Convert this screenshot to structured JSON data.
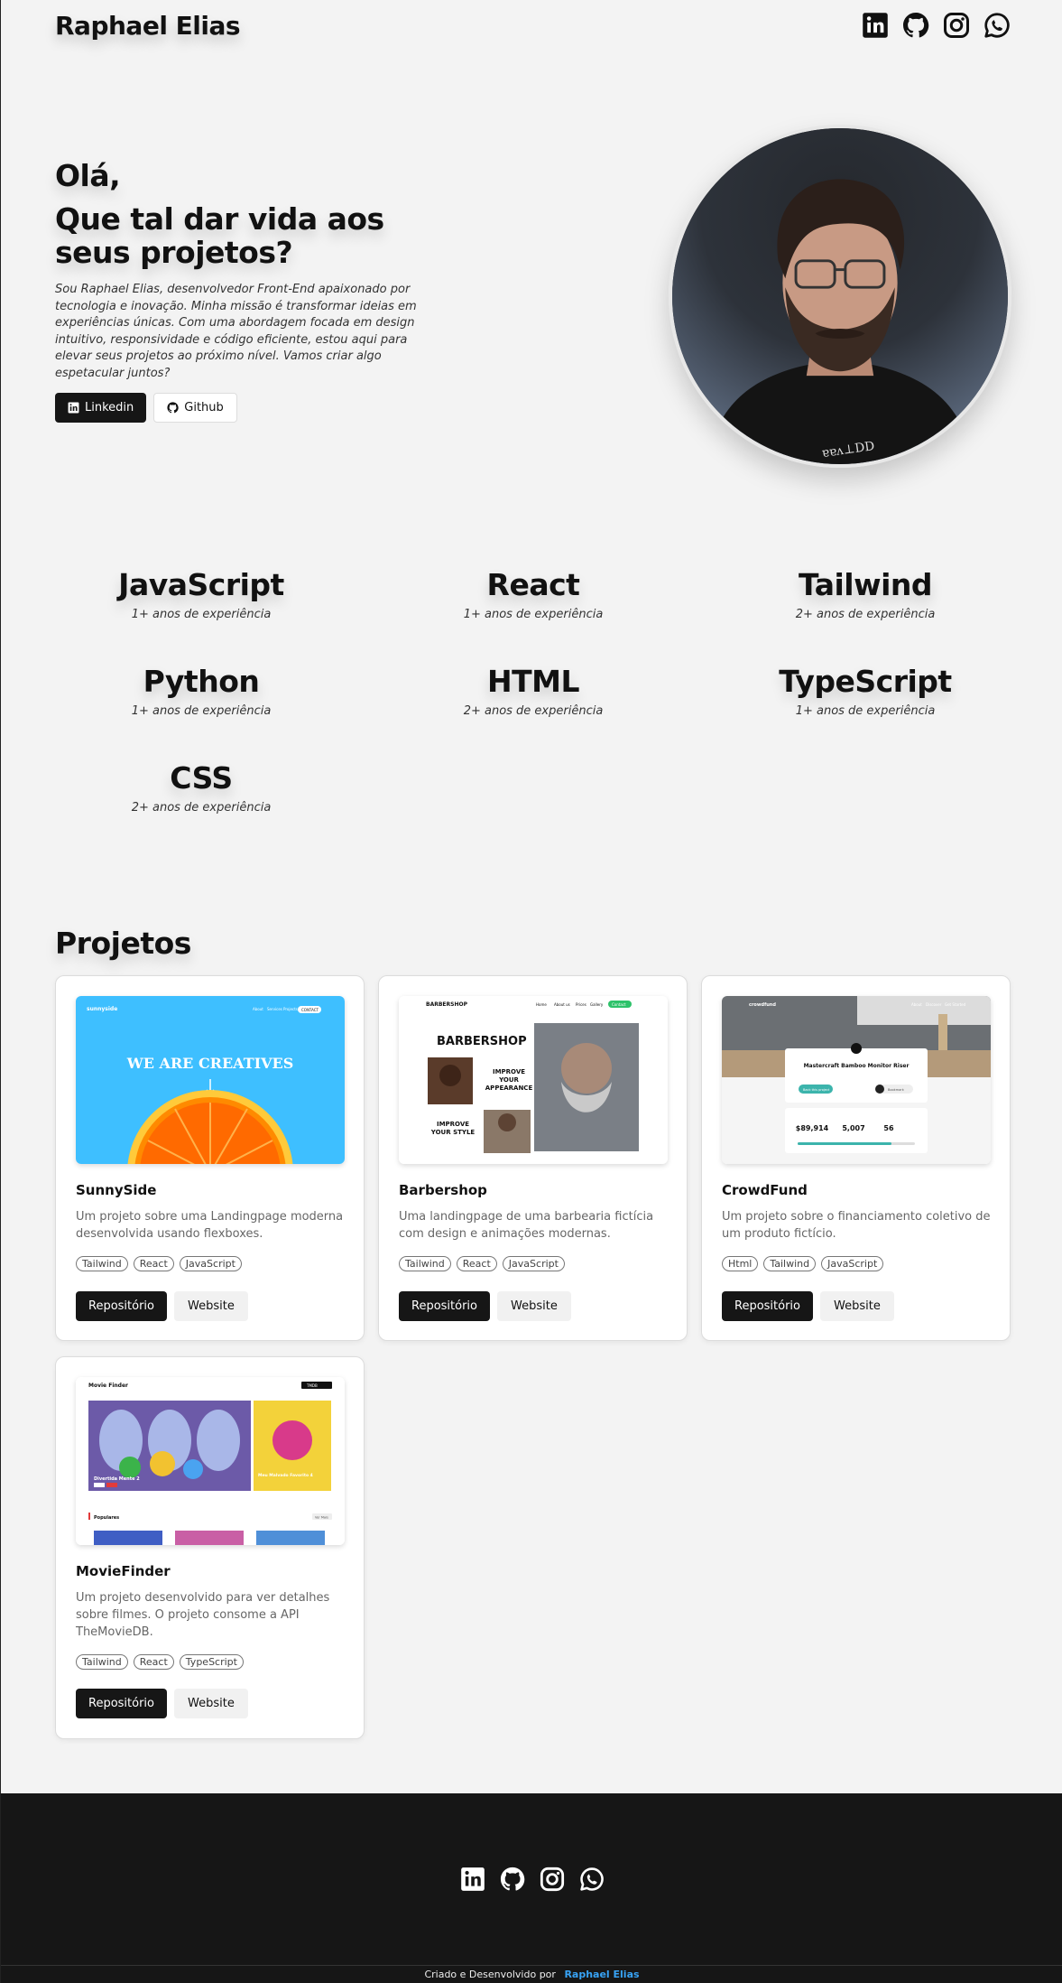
{
  "header": {
    "brand": "Raphael Elias",
    "social_icons": [
      "linkedin-icon",
      "github-icon",
      "instagram-icon",
      "whatsapp-icon"
    ]
  },
  "hero": {
    "greeting": "Olá,",
    "title": "Que tal dar vida aos seus projetos?",
    "description": "Sou Raphael Elias, desenvolvedor Front-End apaixonado por tecnologia e inovação. Minha missão é transformar ideias em experiências únicas. Com uma abordagem focada em design intuitivo, responsividade e código eficiente, estou aqui para elevar seus projetos ao próximo nível. Vamos criar algo espetacular juntos?",
    "buttons": [
      {
        "label": "Linkedin",
        "icon": "linkedin-icon"
      },
      {
        "label": "Github",
        "icon": "github-icon"
      }
    ]
  },
  "skills": [
    {
      "name": "JavaScript",
      "experience": "1+ anos de experiência"
    },
    {
      "name": "React",
      "experience": "1+ anos de experiência"
    },
    {
      "name": "Tailwind",
      "experience": "2+ anos de experiência"
    },
    {
      "name": "Python",
      "experience": "1+ anos de experiência"
    },
    {
      "name": "HTML",
      "experience": "2+ anos de experiência"
    },
    {
      "name": "TypeScript",
      "experience": "1+ anos de experiência"
    },
    {
      "name": "CSS",
      "experience": "2+ anos de experiência"
    }
  ],
  "projects": {
    "heading": "Projetos",
    "items": [
      {
        "title": "SunnySide",
        "description": "Um projeto sobre uma Landingpage moderna desenvolvida usando flexboxes.",
        "tags": [
          "Tailwind",
          "React",
          "JavaScript"
        ],
        "repo_label": "Repositório",
        "site_label": "Website",
        "thumb": {
          "logo": "sunnyside",
          "nav": [
            "About",
            "Services",
            "Projects"
          ],
          "cta": "CONTACT",
          "headline": "WE ARE CREATIVES"
        }
      },
      {
        "title": "Barbershop",
        "description": "Uma landingpage de uma barbearia fictícia com design e animações modernas.",
        "tags": [
          "Tailwind",
          "React",
          "JavaScript"
        ],
        "repo_label": "Repositório",
        "site_label": "Website",
        "thumb": {
          "logo": "BARBERSHOP",
          "nav": [
            "Home",
            "About us",
            "Prices",
            "Gallery"
          ],
          "cta": "Contact",
          "headline": "BARBERSHOP",
          "tag1": "IMPROVE YOUR APPEARANCE",
          "tag2": "IMPROVE YOUR STYLE"
        }
      },
      {
        "title": "CrowdFund",
        "description": "Um projeto sobre o financiamento coletivo de um produto fictício.",
        "tags": [
          "Html",
          "Tailwind",
          "JavaScript"
        ],
        "repo_label": "Repositório",
        "site_label": "Website",
        "thumb": {
          "logo": "crowdfund",
          "nav": [
            "About",
            "Discover",
            "Get Started"
          ],
          "headline": "Mastercraft Bamboo Monitor Riser",
          "back_label": "Back this project",
          "bookmark": "Bookmark",
          "stats": [
            "$89,914",
            "5,007",
            "56"
          ]
        }
      },
      {
        "title": "MovieFinder",
        "description": "Um projeto desenvolvido para ver detalhes sobre filmes. O projeto consome a API TheMovieDB.",
        "tags": [
          "Tailwind",
          "React",
          "TypeScript"
        ],
        "repo_label": "Repositório",
        "site_label": "Website",
        "thumb": {
          "logo": "Movie Finder",
          "badge": "TMDB",
          "slide1": "Divertida Mente 2",
          "slide2": "Meu Malvado Favorito 4",
          "section": "Populares",
          "more": "Ver Mais"
        }
      }
    ]
  },
  "footer": {
    "social_icons": [
      "linkedin-icon",
      "github-icon",
      "instagram-icon",
      "whatsapp-icon"
    ],
    "credit_prefix": "Criado e Desenvolvido por",
    "credit_author": "Raphael Elias"
  },
  "colors": {
    "background": "#f3f3f3",
    "dark": "#161616",
    "accent_link": "#38a3f5"
  }
}
